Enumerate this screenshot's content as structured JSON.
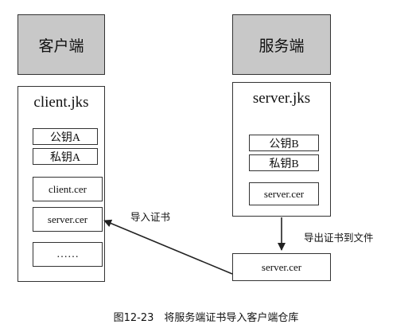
{
  "client": {
    "header": "客户端",
    "keystore": "client.jks",
    "items": [
      "公钥A",
      "私钥A",
      "client.cer",
      "server.cer",
      "……"
    ]
  },
  "server": {
    "header": "服务端",
    "keystore": "server.jks",
    "items": [
      "公钥B",
      "私钥B",
      "server.cer"
    ]
  },
  "exported_file": "server.cer",
  "labels": {
    "export": "导出证书到文件",
    "import": "导入证书"
  },
  "caption": "图12-23　将服务端证书导入客户端仓库",
  "colors": {
    "header_fill": "#c8c8c8",
    "border": "#333333"
  }
}
